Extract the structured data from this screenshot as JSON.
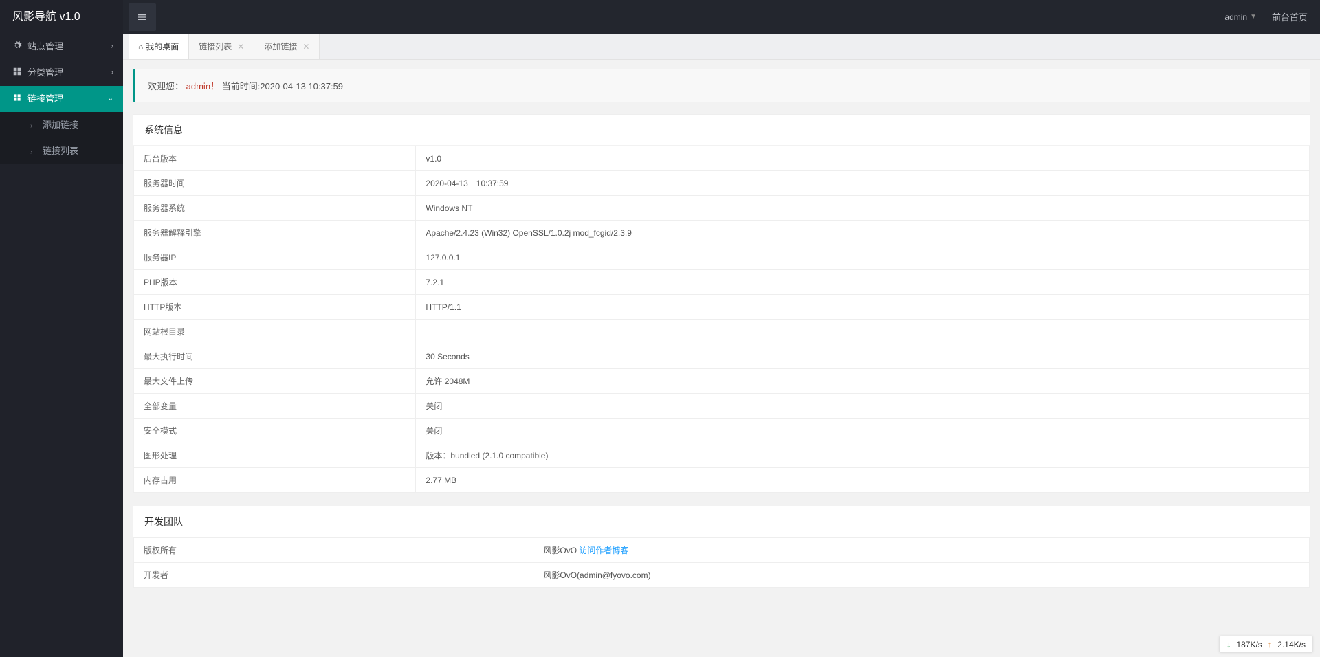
{
  "brand": "风影导航 v1.0",
  "header": {
    "user": "admin",
    "front_link": "前台首页"
  },
  "sidebar": {
    "items": [
      {
        "label": "站点管理",
        "icon": "gear"
      },
      {
        "label": "分类管理",
        "icon": "grid"
      },
      {
        "label": "链接管理",
        "icon": "link",
        "active": true,
        "children": [
          {
            "label": "添加链接"
          },
          {
            "label": "链接列表"
          }
        ]
      }
    ]
  },
  "tabs": [
    {
      "label": "我的桌面",
      "active": true,
      "home": true,
      "closable": false
    },
    {
      "label": "链接列表",
      "active": false,
      "closable": true
    },
    {
      "label": "添加链接",
      "active": false,
      "closable": true
    }
  ],
  "welcome": {
    "prefix": "欢迎您：",
    "user": "admin！",
    "time_label": "当前时间:",
    "time_value": "2020-04-13 10:37:59"
  },
  "sysinfo": {
    "title": "系统信息",
    "rows": [
      {
        "k": "后台版本",
        "v": "v1.0"
      },
      {
        "k": "服务器时间",
        "v": "2020-04-13　10:37:59"
      },
      {
        "k": "服务器系统",
        "v": "Windows NT"
      },
      {
        "k": "服务器解释引擎",
        "v": "Apache/2.4.23 (Win32) OpenSSL/1.0.2j mod_fcgid/2.3.9"
      },
      {
        "k": "服务器IP",
        "v": "127.0.0.1"
      },
      {
        "k": "PHP版本",
        "v": "7.2.1"
      },
      {
        "k": "HTTP版本",
        "v": "HTTP/1.1"
      },
      {
        "k": "网站根目录",
        "v": ""
      },
      {
        "k": "最大执行时间",
        "v": "30 Seconds"
      },
      {
        "k": "最大文件上传",
        "v": "允许 2048M"
      },
      {
        "k": "全部变量",
        "v": "关闭"
      },
      {
        "k": "安全模式",
        "v": "关闭"
      },
      {
        "k": "图形处理",
        "v": "版本：bundled (2.1.0 compatible)"
      },
      {
        "k": "内存占用",
        "v": "2.77 MB"
      }
    ]
  },
  "devteam": {
    "title": "开发团队",
    "rows": [
      {
        "k": "版权所有",
        "v": "风影OvO ",
        "link": "访问作者博客"
      },
      {
        "k": "开发者",
        "v": "风影OvO(admin@fyovo.com)"
      }
    ]
  },
  "net": {
    "down": "187K/s",
    "up": "2.14K/s"
  }
}
